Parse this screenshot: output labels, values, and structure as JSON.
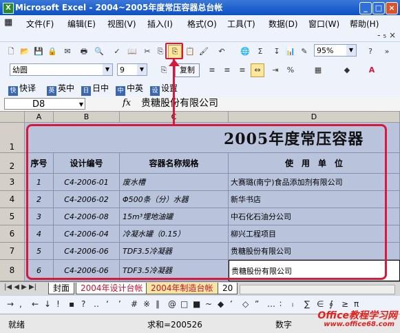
{
  "window": {
    "title": "Microsoft Excel - 2004~2005年度常压容器总台帐",
    "app_icon": "X"
  },
  "menu": {
    "items": [
      "文件(F)",
      "编辑(E)",
      "视图(V)",
      "插入(I)",
      "格式(O)",
      "工具(T)",
      "数据(D)",
      "窗口(W)",
      "帮助(H)"
    ],
    "help_controls": "- ₅ ×"
  },
  "toolbar_format": {
    "font": "幼圆",
    "size": "9",
    "copy_label": "复制",
    "zoom": "95%"
  },
  "toolbar_translate": {
    "items": [
      "快译",
      "英中",
      "日中",
      "中英",
      "设置"
    ],
    "icons": [
      "快",
      "英",
      "日",
      "中",
      "设"
    ]
  },
  "formula_bar": {
    "name_box": "D8",
    "fx": "fx",
    "value": "贵糖股份有限公司"
  },
  "grid": {
    "columns": [
      "A",
      "B",
      "C",
      "D"
    ],
    "rows": [
      "1",
      "2",
      "3",
      "4",
      "5",
      "6",
      "7",
      "8"
    ],
    "title": "2005年度常压容器",
    "headers": [
      "序号",
      "设计编号",
      "容器名称规格",
      "使　用　单　位"
    ],
    "data": [
      [
        "1",
        "C4-2006-01",
        "废水槽",
        "大赛璐(南宁)食品添加剂有限公司"
      ],
      [
        "2",
        "C4-2006-02",
        "Φ500条（分）水器",
        "新华书店"
      ],
      [
        "3",
        "C4-2006-08",
        "15m³埋地油罐",
        "中石化石油分公司"
      ],
      [
        "4",
        "C4-2006-04",
        "冷凝水罐（0.15）",
        "柳兴工程项目"
      ],
      [
        "5",
        "C4-2006-06",
        "TDF3.5冷凝器",
        "贵糖股份有限公司"
      ],
      [
        "6",
        "C4-2006-06",
        "TDF3.5冷凝器",
        "贵糖股份有限公司"
      ]
    ]
  },
  "tabs": [
    "封面",
    "2004年设计台帐",
    "2004年制造台帐",
    "20"
  ],
  "tab_nav": "|◀ ◀ ▶ ▶|",
  "drawbar": [
    "→",
    "‚",
    "←",
    "↓",
    "!",
    "▪",
    "?",
    "‥",
    "‘",
    "’",
    "#",
    "※",
    "∥",
    "@",
    "□",
    "■",
    "~",
    "◆",
    "’",
    "◇",
    "”",
    "…",
    "∶",
    "ₗ",
    "∑",
    "∈",
    "∮",
    "≥",
    "π"
  ],
  "status": {
    "left": "就绪",
    "sum": "求和=200526",
    "mode": "数字"
  },
  "watermark": {
    "line1": "Office教程学习网",
    "line2": "www.office68.com"
  },
  "colors": {
    "title_bar": "#0b4fc4",
    "cell_fill": "#b9c3dc",
    "highlight_red": "#d6193a",
    "tab_red": "#c8102e"
  }
}
